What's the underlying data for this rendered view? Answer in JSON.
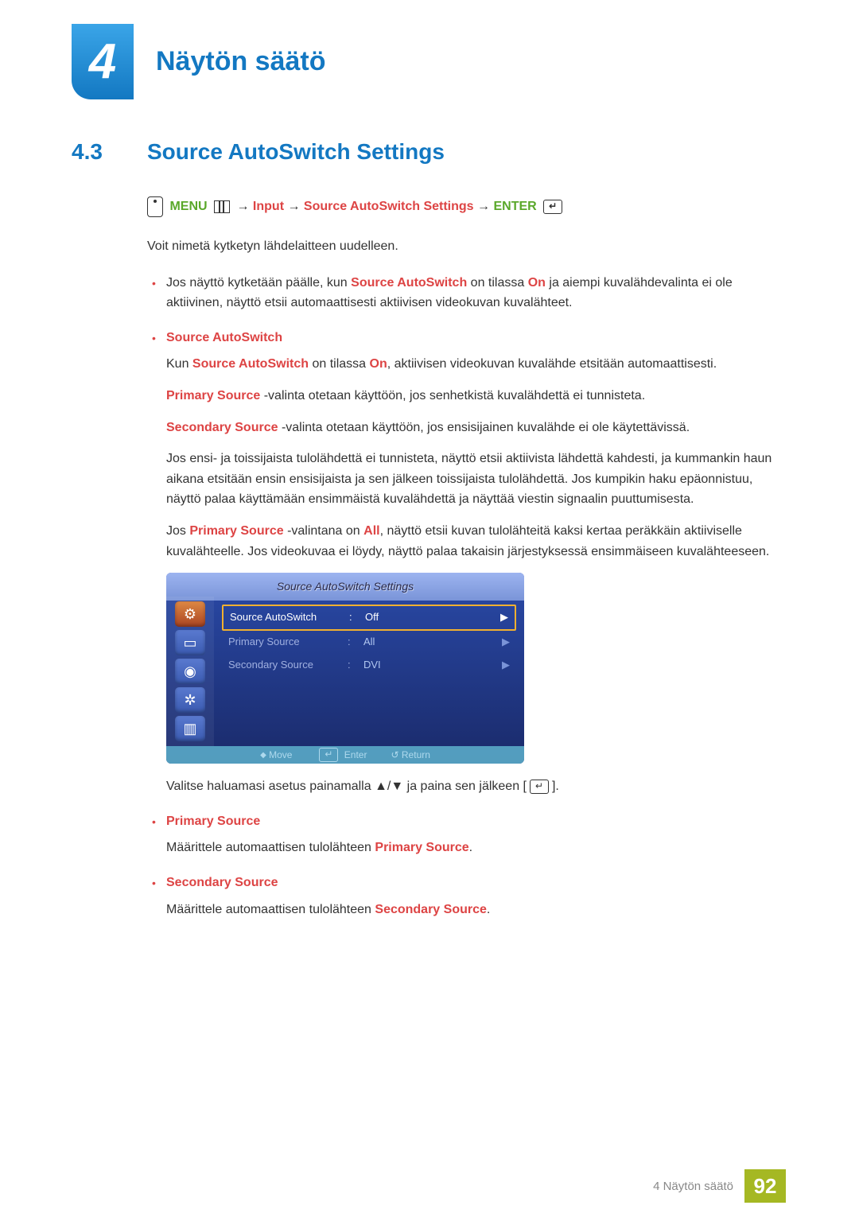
{
  "chapter": {
    "number": "4",
    "title": "Näytön säätö"
  },
  "section": {
    "number": "4.3",
    "title": "Source AutoSwitch Settings"
  },
  "nav": {
    "menu": "MENU",
    "input": "Input",
    "target": "Source AutoSwitch Settings",
    "enter": "ENTER",
    "arrow": "→"
  },
  "intro": "Voit nimetä kytketyn lähdelaitteen uudelleen.",
  "b1_a": "Jos näyttö kytketään päälle, kun ",
  "b1_b": "Source AutoSwitch",
  "b1_c": " on tilassa ",
  "b1_d": "On",
  "b1_e": " ja aiempi kuvalähdevalinta ei ole aktiivinen, näyttö etsii automaattisesti aktiivisen videokuvan kuvalähteet.",
  "h_sas": "Source AutoSwitch",
  "p_sas_a": "Kun ",
  "p_sas_b": "Source AutoSwitch",
  "p_sas_c": " on tilassa ",
  "p_sas_d": "On",
  "p_sas_e": ", aktiivisen videokuvan kuvalähde etsitään automaattisesti.",
  "p_prim_a": "Primary Source",
  "p_prim_b": " -valinta otetaan käyttöön, jos senhetkistä kuvalähdettä ei tunnisteta.",
  "p_sec_a": "Secondary Source",
  "p_sec_b": " -valinta otetaan käyttöön, jos ensisijainen kuvalähde ei ole käytettävissä.",
  "p_long": "Jos ensi- ja toissijaista tulolähdettä ei tunnisteta, näyttö etsii aktiivista lähdettä kahdesti, ja kummankin haun aikana etsitään ensin ensisijaista ja sen jälkeen toissijaista tulolähdettä. Jos kumpikin haku epäonnistuu, näyttö palaa käyttämään ensimmäistä kuvalähdettä ja näyttää viestin signaalin puuttumisesta.",
  "p_all_a": "Jos ",
  "p_all_b": "Primary Source",
  "p_all_c": " -valintana on ",
  "p_all_d": "All",
  "p_all_e": ", näyttö etsii kuvan tulolähteitä kaksi kertaa peräkkäin aktiiviselle kuvalähteelle. Jos videokuvaa ei löydy, näyttö palaa takaisin järjestyksessä ensimmäiseen kuvalähteeseen.",
  "osd": {
    "title": "Source AutoSwitch Settings",
    "rows": [
      {
        "label": "Source AutoSwitch",
        "value": "Off",
        "sel": true
      },
      {
        "label": "Primary Source",
        "value": "All",
        "sel": false
      },
      {
        "label": "Secondary Source",
        "value": "DVI",
        "sel": false
      }
    ],
    "footer": {
      "move": "Move",
      "enter": "Enter",
      "return": "Return"
    }
  },
  "after_osd_a": "Valitse haluamasi asetus painamalla ",
  "after_osd_arrows": "▲/▼",
  "after_osd_b": " ja paina sen jälkeen [",
  "after_osd_c": "].",
  "h_prim": "Primary Source",
  "p_prim2_a": "Määrittele automaattisen tulolähteen ",
  "p_prim2_b": "Primary Source",
  "p_prim2_c": ".",
  "h_sec": "Secondary Source",
  "p_sec2_a": "Määrittele automaattisen tulolähteen ",
  "p_sec2_b": "Secondary Source",
  "p_sec2_c": ".",
  "footer": {
    "text": "4 Näytön säätö",
    "page": "92"
  }
}
